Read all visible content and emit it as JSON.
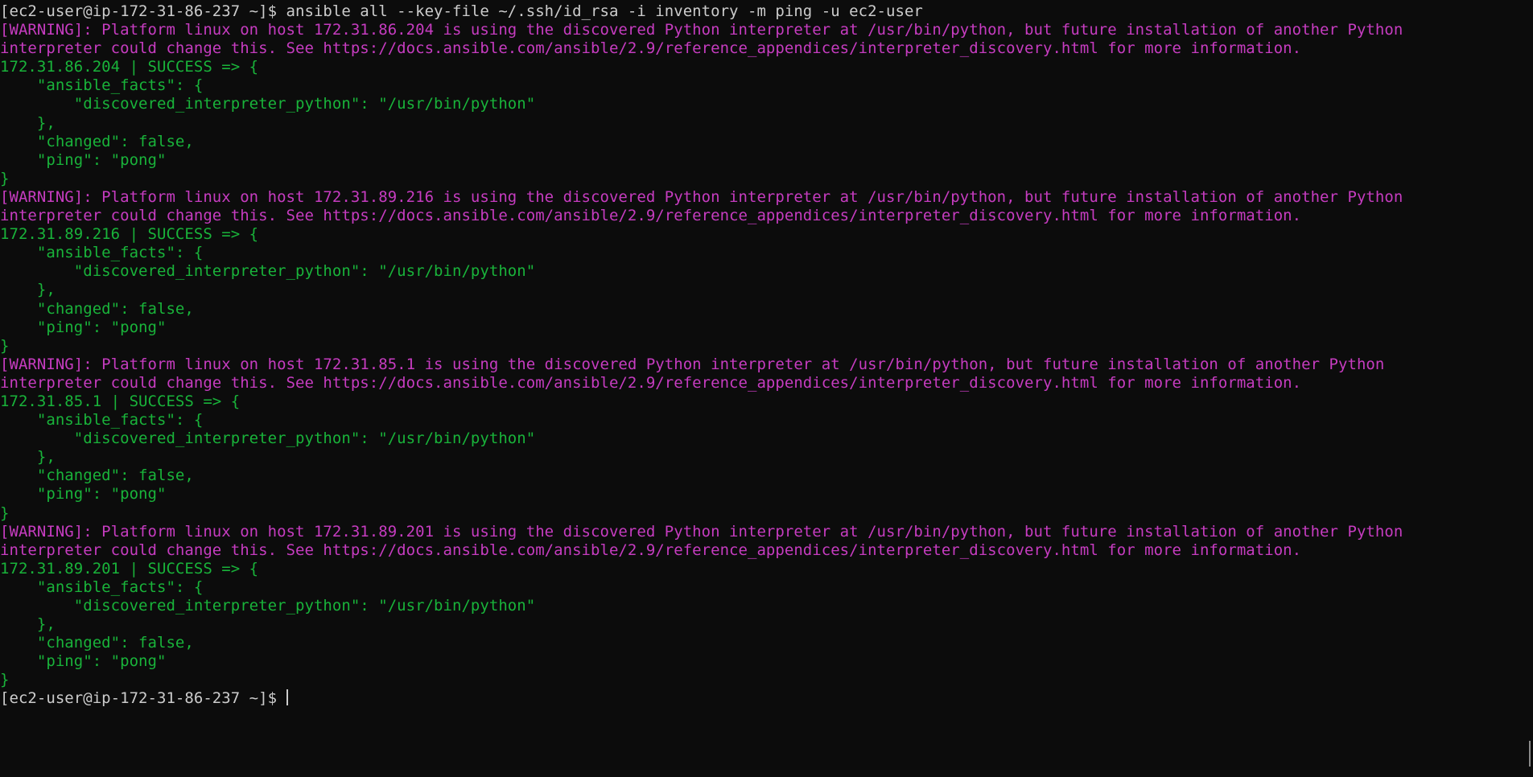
{
  "colors": {
    "background": "#0c0c0c",
    "default": "#cccccc",
    "warning": "#c63cc0",
    "success": "#19b33a"
  },
  "command_line": {
    "prompt": "[ec2-user@ip-172-31-86-237 ~]$ ",
    "command": "ansible all --key-file ~/.ssh/id_rsa -i inventory -m ping -u ec2-user"
  },
  "hosts": [
    {
      "warning_1": "[WARNING]: Platform linux on host 172.31.86.204 is using the discovered Python interpreter at /usr/bin/python, but future installation of another Python",
      "warning_2": "interpreter could change this. See https://docs.ansible.com/ansible/2.9/reference_appendices/interpreter_discovery.html for more information.",
      "result": "172.31.86.204 | SUCCESS => {",
      "facts_open": "    \"ansible_facts\": {",
      "interpreter": "        \"discovered_interpreter_python\": \"/usr/bin/python\"",
      "facts_close": "    },",
      "changed": "    \"changed\": false,",
      "ping": "    \"ping\": \"pong\"",
      "close": "}"
    },
    {
      "warning_1": "[WARNING]: Platform linux on host 172.31.89.216 is using the discovered Python interpreter at /usr/bin/python, but future installation of another Python",
      "warning_2": "interpreter could change this. See https://docs.ansible.com/ansible/2.9/reference_appendices/interpreter_discovery.html for more information.",
      "result": "172.31.89.216 | SUCCESS => {",
      "facts_open": "    \"ansible_facts\": {",
      "interpreter": "        \"discovered_interpreter_python\": \"/usr/bin/python\"",
      "facts_close": "    },",
      "changed": "    \"changed\": false,",
      "ping": "    \"ping\": \"pong\"",
      "close": "}"
    },
    {
      "warning_1": "[WARNING]: Platform linux on host 172.31.85.1 is using the discovered Python interpreter at /usr/bin/python, but future installation of another Python",
      "warning_2": "interpreter could change this. See https://docs.ansible.com/ansible/2.9/reference_appendices/interpreter_discovery.html for more information.",
      "result": "172.31.85.1 | SUCCESS => {",
      "facts_open": "    \"ansible_facts\": {",
      "interpreter": "        \"discovered_interpreter_python\": \"/usr/bin/python\"",
      "facts_close": "    },",
      "changed": "    \"changed\": false,",
      "ping": "    \"ping\": \"pong\"",
      "close": "}"
    },
    {
      "warning_1": "[WARNING]: Platform linux on host 172.31.89.201 is using the discovered Python interpreter at /usr/bin/python, but future installation of another Python",
      "warning_2": "interpreter could change this. See https://docs.ansible.com/ansible/2.9/reference_appendices/interpreter_discovery.html for more information.",
      "result": "172.31.89.201 | SUCCESS => {",
      "facts_open": "    \"ansible_facts\": {",
      "interpreter": "        \"discovered_interpreter_python\": \"/usr/bin/python\"",
      "facts_close": "    },",
      "changed": "    \"changed\": false,",
      "ping": "    \"ping\": \"pong\"",
      "close": "}"
    }
  ],
  "final_prompt": "[ec2-user@ip-172-31-86-237 ~]$ "
}
